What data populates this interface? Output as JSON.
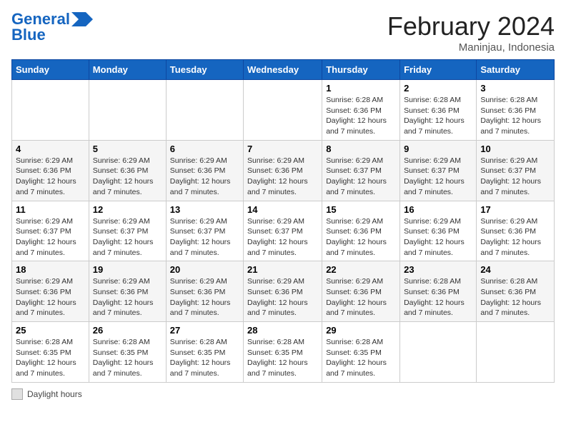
{
  "header": {
    "logo_line1": "General",
    "logo_line2": "Blue",
    "month_title": "February 2024",
    "location": "Maninjau, Indonesia"
  },
  "footer": {
    "legend_label": "Daylight hours"
  },
  "days_of_week": [
    "Sunday",
    "Monday",
    "Tuesday",
    "Wednesday",
    "Thursday",
    "Friday",
    "Saturday"
  ],
  "weeks": [
    [
      {
        "num": "",
        "detail": ""
      },
      {
        "num": "",
        "detail": ""
      },
      {
        "num": "",
        "detail": ""
      },
      {
        "num": "",
        "detail": ""
      },
      {
        "num": "1",
        "detail": "Sunrise: 6:28 AM\nSunset: 6:36 PM\nDaylight: 12 hours and 7 minutes."
      },
      {
        "num": "2",
        "detail": "Sunrise: 6:28 AM\nSunset: 6:36 PM\nDaylight: 12 hours and 7 minutes."
      },
      {
        "num": "3",
        "detail": "Sunrise: 6:28 AM\nSunset: 6:36 PM\nDaylight: 12 hours and 7 minutes."
      }
    ],
    [
      {
        "num": "4",
        "detail": "Sunrise: 6:29 AM\nSunset: 6:36 PM\nDaylight: 12 hours and 7 minutes."
      },
      {
        "num": "5",
        "detail": "Sunrise: 6:29 AM\nSunset: 6:36 PM\nDaylight: 12 hours and 7 minutes."
      },
      {
        "num": "6",
        "detail": "Sunrise: 6:29 AM\nSunset: 6:36 PM\nDaylight: 12 hours and 7 minutes."
      },
      {
        "num": "7",
        "detail": "Sunrise: 6:29 AM\nSunset: 6:36 PM\nDaylight: 12 hours and 7 minutes."
      },
      {
        "num": "8",
        "detail": "Sunrise: 6:29 AM\nSunset: 6:37 PM\nDaylight: 12 hours and 7 minutes."
      },
      {
        "num": "9",
        "detail": "Sunrise: 6:29 AM\nSunset: 6:37 PM\nDaylight: 12 hours and 7 minutes."
      },
      {
        "num": "10",
        "detail": "Sunrise: 6:29 AM\nSunset: 6:37 PM\nDaylight: 12 hours and 7 minutes."
      }
    ],
    [
      {
        "num": "11",
        "detail": "Sunrise: 6:29 AM\nSunset: 6:37 PM\nDaylight: 12 hours and 7 minutes."
      },
      {
        "num": "12",
        "detail": "Sunrise: 6:29 AM\nSunset: 6:37 PM\nDaylight: 12 hours and 7 minutes."
      },
      {
        "num": "13",
        "detail": "Sunrise: 6:29 AM\nSunset: 6:37 PM\nDaylight: 12 hours and 7 minutes."
      },
      {
        "num": "14",
        "detail": "Sunrise: 6:29 AM\nSunset: 6:37 PM\nDaylight: 12 hours and 7 minutes."
      },
      {
        "num": "15",
        "detail": "Sunrise: 6:29 AM\nSunset: 6:36 PM\nDaylight: 12 hours and 7 minutes."
      },
      {
        "num": "16",
        "detail": "Sunrise: 6:29 AM\nSunset: 6:36 PM\nDaylight: 12 hours and 7 minutes."
      },
      {
        "num": "17",
        "detail": "Sunrise: 6:29 AM\nSunset: 6:36 PM\nDaylight: 12 hours and 7 minutes."
      }
    ],
    [
      {
        "num": "18",
        "detail": "Sunrise: 6:29 AM\nSunset: 6:36 PM\nDaylight: 12 hours and 7 minutes."
      },
      {
        "num": "19",
        "detail": "Sunrise: 6:29 AM\nSunset: 6:36 PM\nDaylight: 12 hours and 7 minutes."
      },
      {
        "num": "20",
        "detail": "Sunrise: 6:29 AM\nSunset: 6:36 PM\nDaylight: 12 hours and 7 minutes."
      },
      {
        "num": "21",
        "detail": "Sunrise: 6:29 AM\nSunset: 6:36 PM\nDaylight: 12 hours and 7 minutes."
      },
      {
        "num": "22",
        "detail": "Sunrise: 6:29 AM\nSunset: 6:36 PM\nDaylight: 12 hours and 7 minutes."
      },
      {
        "num": "23",
        "detail": "Sunrise: 6:28 AM\nSunset: 6:36 PM\nDaylight: 12 hours and 7 minutes."
      },
      {
        "num": "24",
        "detail": "Sunrise: 6:28 AM\nSunset: 6:36 PM\nDaylight: 12 hours and 7 minutes."
      }
    ],
    [
      {
        "num": "25",
        "detail": "Sunrise: 6:28 AM\nSunset: 6:35 PM\nDaylight: 12 hours and 7 minutes."
      },
      {
        "num": "26",
        "detail": "Sunrise: 6:28 AM\nSunset: 6:35 PM\nDaylight: 12 hours and 7 minutes."
      },
      {
        "num": "27",
        "detail": "Sunrise: 6:28 AM\nSunset: 6:35 PM\nDaylight: 12 hours and 7 minutes."
      },
      {
        "num": "28",
        "detail": "Sunrise: 6:28 AM\nSunset: 6:35 PM\nDaylight: 12 hours and 7 minutes."
      },
      {
        "num": "29",
        "detail": "Sunrise: 6:28 AM\nSunset: 6:35 PM\nDaylight: 12 hours and 7 minutes."
      },
      {
        "num": "",
        "detail": ""
      },
      {
        "num": "",
        "detail": ""
      }
    ]
  ]
}
